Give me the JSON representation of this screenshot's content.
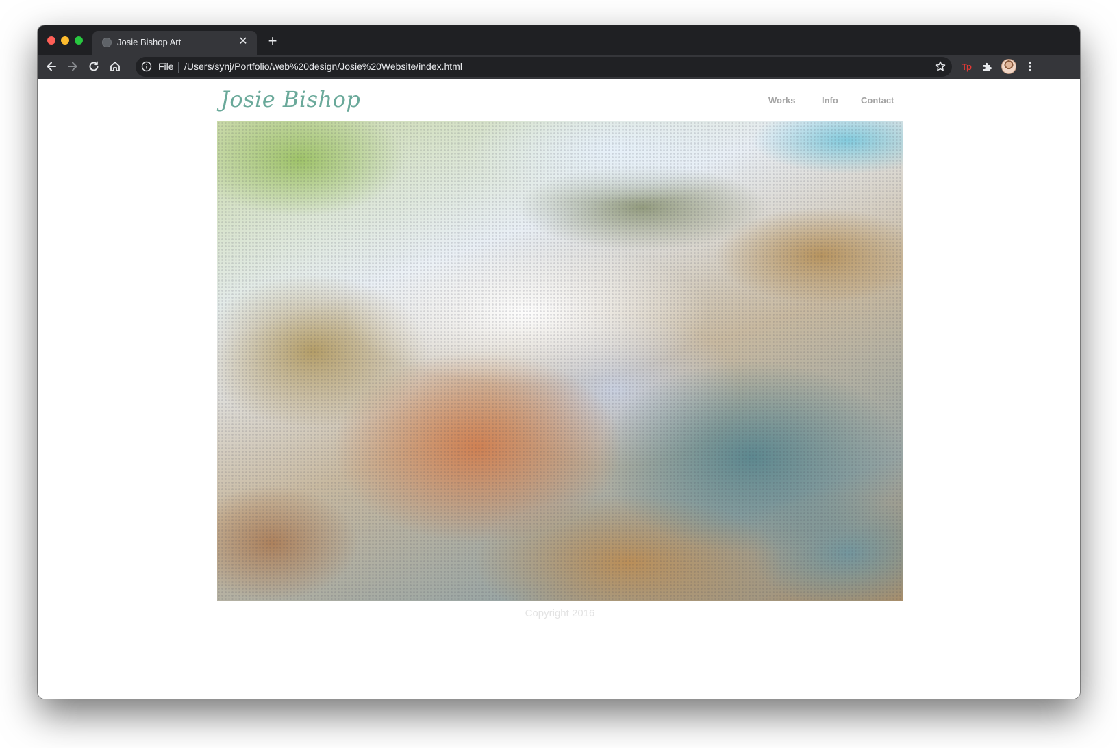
{
  "browser": {
    "tab": {
      "title": "Josie Bishop Art",
      "close_glyph": "✕"
    },
    "new_tab_glyph": "+",
    "address_bar": {
      "scheme_label": "File",
      "url": "/Users/synj/Portfolio/web%20design/Josie%20Website/index.html"
    },
    "extensions": {
      "tp_label": "Tp"
    }
  },
  "site": {
    "logo": "Josie Bishop",
    "nav": [
      {
        "label": "Works"
      },
      {
        "label": "Info"
      },
      {
        "label": "Contact"
      }
    ],
    "footer": {
      "copyright": "Copyright 2016"
    }
  },
  "colors": {
    "chrome_frame": "#1f2023",
    "chrome_toolbar": "#35363a",
    "logo_accent": "#6aa99a",
    "nav_text": "#a3a3a3",
    "copyright_text": "#e3e3e3"
  },
  "icons": [
    "globe-icon",
    "close-icon",
    "plus-icon",
    "back-arrow-icon",
    "forward-arrow-icon",
    "reload-icon",
    "home-icon",
    "info-icon",
    "star-icon",
    "puzzle-icon",
    "avatar",
    "more-vert-icon"
  ]
}
